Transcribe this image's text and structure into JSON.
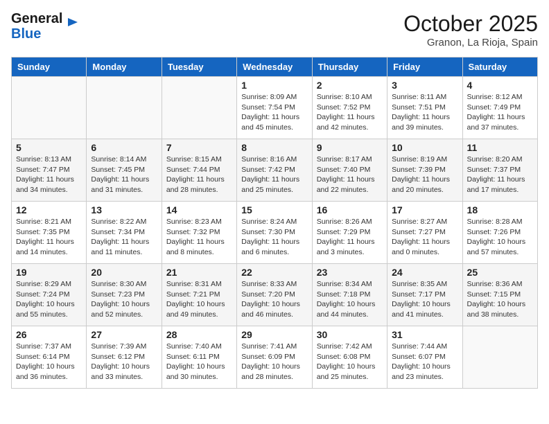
{
  "header": {
    "logo_line1": "General",
    "logo_line2": "Blue",
    "month": "October 2025",
    "location": "Granon, La Rioja, Spain"
  },
  "weekdays": [
    "Sunday",
    "Monday",
    "Tuesday",
    "Wednesday",
    "Thursday",
    "Friday",
    "Saturday"
  ],
  "weeks": [
    [
      {
        "day": "",
        "info": ""
      },
      {
        "day": "",
        "info": ""
      },
      {
        "day": "",
        "info": ""
      },
      {
        "day": "1",
        "info": "Sunrise: 8:09 AM\nSunset: 7:54 PM\nDaylight: 11 hours and 45 minutes."
      },
      {
        "day": "2",
        "info": "Sunrise: 8:10 AM\nSunset: 7:52 PM\nDaylight: 11 hours and 42 minutes."
      },
      {
        "day": "3",
        "info": "Sunrise: 8:11 AM\nSunset: 7:51 PM\nDaylight: 11 hours and 39 minutes."
      },
      {
        "day": "4",
        "info": "Sunrise: 8:12 AM\nSunset: 7:49 PM\nDaylight: 11 hours and 37 minutes."
      }
    ],
    [
      {
        "day": "5",
        "info": "Sunrise: 8:13 AM\nSunset: 7:47 PM\nDaylight: 11 hours and 34 minutes."
      },
      {
        "day": "6",
        "info": "Sunrise: 8:14 AM\nSunset: 7:45 PM\nDaylight: 11 hours and 31 minutes."
      },
      {
        "day": "7",
        "info": "Sunrise: 8:15 AM\nSunset: 7:44 PM\nDaylight: 11 hours and 28 minutes."
      },
      {
        "day": "8",
        "info": "Sunrise: 8:16 AM\nSunset: 7:42 PM\nDaylight: 11 hours and 25 minutes."
      },
      {
        "day": "9",
        "info": "Sunrise: 8:17 AM\nSunset: 7:40 PM\nDaylight: 11 hours and 22 minutes."
      },
      {
        "day": "10",
        "info": "Sunrise: 8:19 AM\nSunset: 7:39 PM\nDaylight: 11 hours and 20 minutes."
      },
      {
        "day": "11",
        "info": "Sunrise: 8:20 AM\nSunset: 7:37 PM\nDaylight: 11 hours and 17 minutes."
      }
    ],
    [
      {
        "day": "12",
        "info": "Sunrise: 8:21 AM\nSunset: 7:35 PM\nDaylight: 11 hours and 14 minutes."
      },
      {
        "day": "13",
        "info": "Sunrise: 8:22 AM\nSunset: 7:34 PM\nDaylight: 11 hours and 11 minutes."
      },
      {
        "day": "14",
        "info": "Sunrise: 8:23 AM\nSunset: 7:32 PM\nDaylight: 11 hours and 8 minutes."
      },
      {
        "day": "15",
        "info": "Sunrise: 8:24 AM\nSunset: 7:30 PM\nDaylight: 11 hours and 6 minutes."
      },
      {
        "day": "16",
        "info": "Sunrise: 8:26 AM\nSunset: 7:29 PM\nDaylight: 11 hours and 3 minutes."
      },
      {
        "day": "17",
        "info": "Sunrise: 8:27 AM\nSunset: 7:27 PM\nDaylight: 11 hours and 0 minutes."
      },
      {
        "day": "18",
        "info": "Sunrise: 8:28 AM\nSunset: 7:26 PM\nDaylight: 10 hours and 57 minutes."
      }
    ],
    [
      {
        "day": "19",
        "info": "Sunrise: 8:29 AM\nSunset: 7:24 PM\nDaylight: 10 hours and 55 minutes."
      },
      {
        "day": "20",
        "info": "Sunrise: 8:30 AM\nSunset: 7:23 PM\nDaylight: 10 hours and 52 minutes."
      },
      {
        "day": "21",
        "info": "Sunrise: 8:31 AM\nSunset: 7:21 PM\nDaylight: 10 hours and 49 minutes."
      },
      {
        "day": "22",
        "info": "Sunrise: 8:33 AM\nSunset: 7:20 PM\nDaylight: 10 hours and 46 minutes."
      },
      {
        "day": "23",
        "info": "Sunrise: 8:34 AM\nSunset: 7:18 PM\nDaylight: 10 hours and 44 minutes."
      },
      {
        "day": "24",
        "info": "Sunrise: 8:35 AM\nSunset: 7:17 PM\nDaylight: 10 hours and 41 minutes."
      },
      {
        "day": "25",
        "info": "Sunrise: 8:36 AM\nSunset: 7:15 PM\nDaylight: 10 hours and 38 minutes."
      }
    ],
    [
      {
        "day": "26",
        "info": "Sunrise: 7:37 AM\nSunset: 6:14 PM\nDaylight: 10 hours and 36 minutes."
      },
      {
        "day": "27",
        "info": "Sunrise: 7:39 AM\nSunset: 6:12 PM\nDaylight: 10 hours and 33 minutes."
      },
      {
        "day": "28",
        "info": "Sunrise: 7:40 AM\nSunset: 6:11 PM\nDaylight: 10 hours and 30 minutes."
      },
      {
        "day": "29",
        "info": "Sunrise: 7:41 AM\nSunset: 6:09 PM\nDaylight: 10 hours and 28 minutes."
      },
      {
        "day": "30",
        "info": "Sunrise: 7:42 AM\nSunset: 6:08 PM\nDaylight: 10 hours and 25 minutes."
      },
      {
        "day": "31",
        "info": "Sunrise: 7:44 AM\nSunset: 6:07 PM\nDaylight: 10 hours and 23 minutes."
      },
      {
        "day": "",
        "info": ""
      }
    ]
  ]
}
